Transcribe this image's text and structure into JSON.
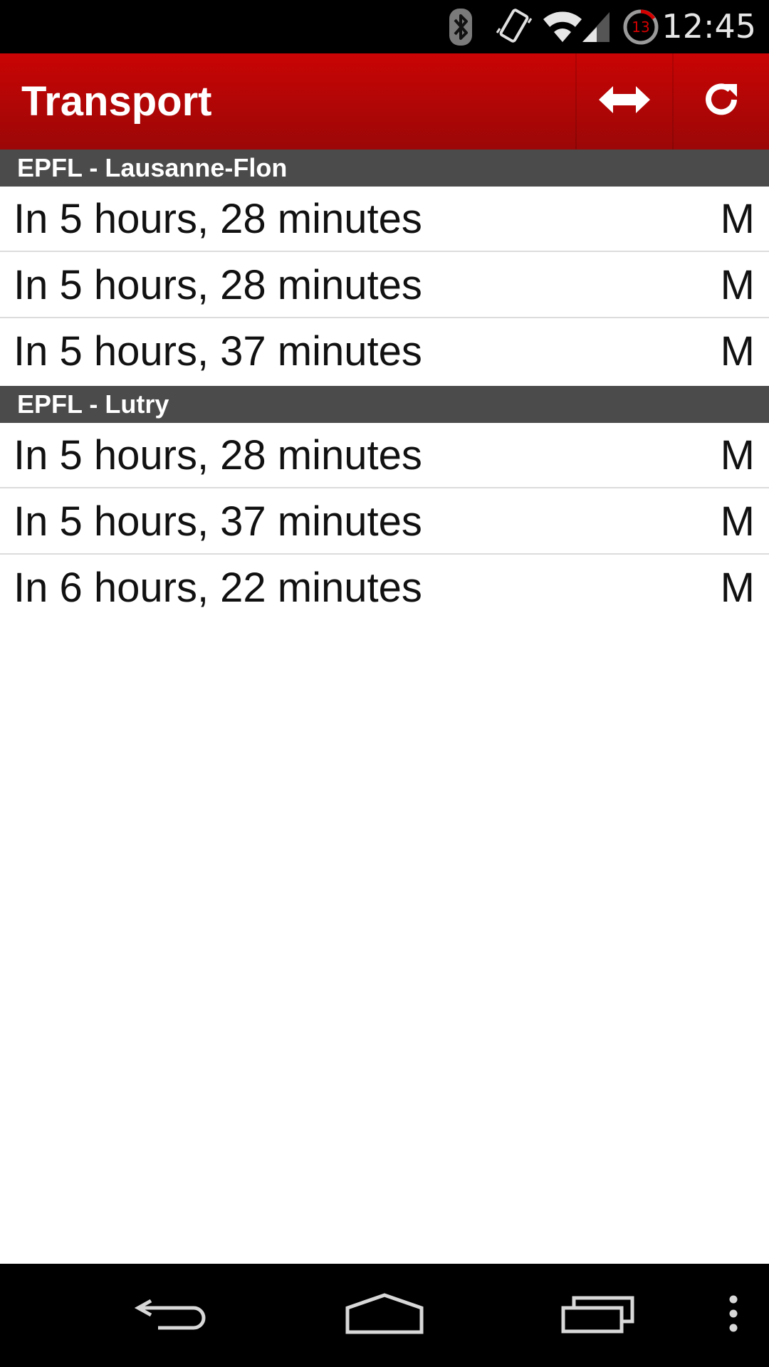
{
  "status_bar": {
    "clock": "12:45",
    "badge_count": "13",
    "icons": [
      "bluetooth-icon",
      "vibrate-icon",
      "wifi-icon",
      "signal-icon",
      "timer-icon"
    ]
  },
  "action_bar": {
    "title": "Transport",
    "color": "#b00606",
    "actions": [
      "swap-direction-icon",
      "refresh-icon"
    ]
  },
  "sections": [
    {
      "header": "EPFL - Lausanne-Flon",
      "departures": [
        {
          "time": "In 5 hours, 28 minutes",
          "line": "M"
        },
        {
          "time": "In 5 hours, 28 minutes",
          "line": "M"
        },
        {
          "time": "In 5 hours, 37 minutes",
          "line": "M"
        }
      ]
    },
    {
      "header": "EPFL - Lutry",
      "departures": [
        {
          "time": "In 5 hours, 28 minutes",
          "line": "M"
        },
        {
          "time": "In 5 hours, 37 minutes",
          "line": "M"
        },
        {
          "time": "In 6 hours, 22 minutes",
          "line": "M"
        }
      ]
    }
  ],
  "nav_bar": {
    "buttons": [
      "back-icon",
      "home-icon",
      "recent-apps-icon",
      "overflow-menu-icon"
    ]
  }
}
